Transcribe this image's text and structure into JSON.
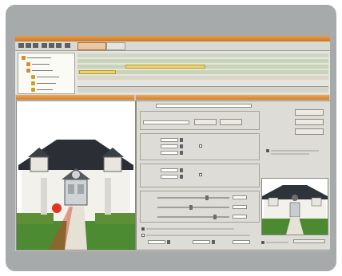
{
  "colors": {
    "frame": "#a7aaab",
    "accent": "#e39a44",
    "clip": "#e7d46a",
    "track": "#c8d3b7"
  },
  "toolbar": {
    "icons": [
      "new-icon",
      "open-icon",
      "save-icon",
      "cut-icon",
      "copy-icon",
      "paste-icon",
      "play-icon",
      "stop-icon",
      "record-icon"
    ]
  },
  "tree": {
    "items": [
      {
        "depth": 0,
        "icon": "folder-icon"
      },
      {
        "depth": 1,
        "icon": "folder-icon"
      },
      {
        "depth": 1,
        "icon": "folder-icon"
      },
      {
        "depth": 2,
        "icon": "clip-icon"
      },
      {
        "depth": 2,
        "icon": "clip-icon"
      },
      {
        "depth": 2,
        "icon": "clip-icon"
      }
    ]
  },
  "viewer": {
    "scene": "house-with-path"
  },
  "dialog": {
    "buttons": [
      "",
      "",
      ""
    ],
    "checkboxes": [
      {
        "checked": true
      },
      {
        "checked": false
      },
      {
        "checked": true
      }
    ]
  }
}
